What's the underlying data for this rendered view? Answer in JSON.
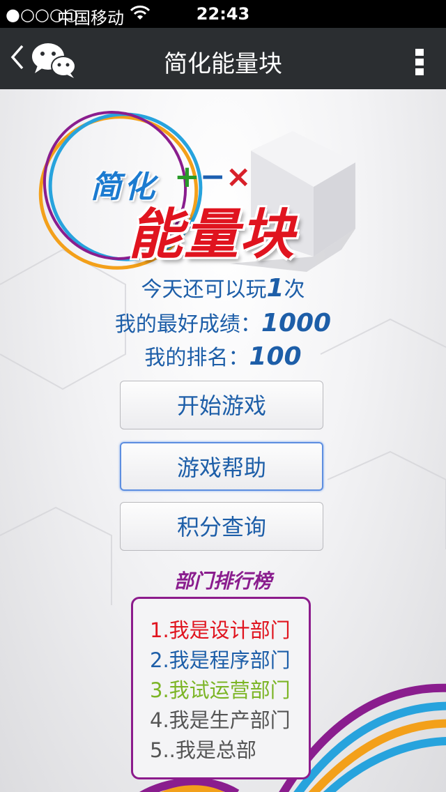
{
  "status_bar": {
    "signal": "●○○○○",
    "carrier": "中国移动",
    "time": "22:43"
  },
  "nav": {
    "title": "简化能量块"
  },
  "logo": {
    "small": "简化",
    "ops": [
      "+",
      "−",
      "×"
    ],
    "big": "能量块"
  },
  "stats": {
    "plays_prefix": "今天还可以玩",
    "plays_value": "1",
    "plays_suffix": "次",
    "best_label": "我的最好成绩：",
    "best_value": "1000",
    "rank_label": "我的排名：",
    "rank_value": "100"
  },
  "buttons": {
    "start": "开始游戏",
    "help": "游戏帮助",
    "points": "积分查询"
  },
  "ranking": {
    "title": "部门排行榜",
    "items": [
      {
        "text": "1.我是设计部门",
        "color": "#e0141f"
      },
      {
        "text": "2.我是程序部门",
        "color": "#1d5ea8"
      },
      {
        "text": "3.我试运营部门",
        "color": "#7cb526"
      },
      {
        "text": "4.我是生产部门",
        "color": "#555555"
      },
      {
        "text": "5..我是总部",
        "color": "#555555"
      }
    ]
  }
}
